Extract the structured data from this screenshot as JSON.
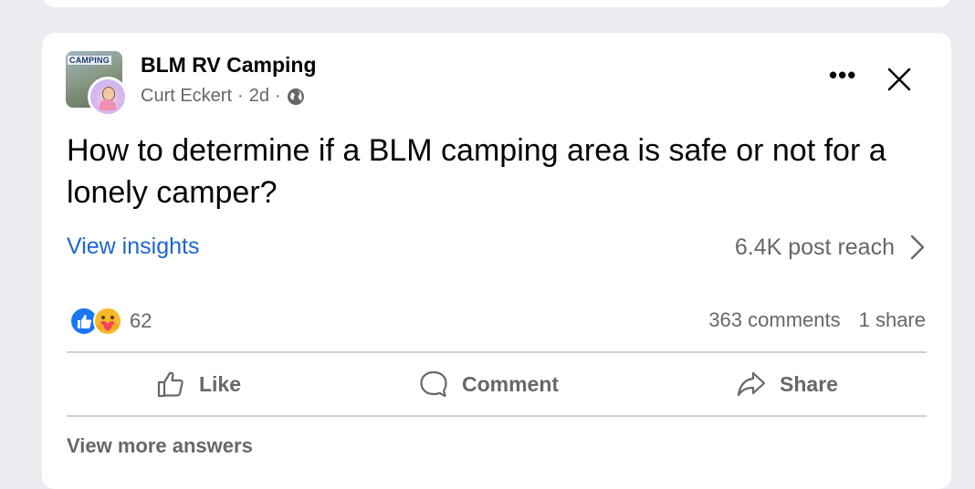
{
  "post": {
    "group_name": "BLM RV Camping",
    "group_avatar_text": "CAMPING",
    "author": "Curt Eckert",
    "time": "2d",
    "separator": "·",
    "text": "How to determine if a BLM camping area is safe or not for a lonely camper?",
    "more_label": "•••"
  },
  "insights": {
    "link_label": "View insights",
    "reach": "6.4K post reach"
  },
  "engagement": {
    "reaction_count": "62",
    "comments": "363 comments",
    "shares": "1 share"
  },
  "actions": {
    "like": "Like",
    "comment": "Comment",
    "share": "Share"
  },
  "footer": {
    "more_answers": "View more answers"
  },
  "colors": {
    "accent": "#1b65d0",
    "secondary_text": "#65676b",
    "like_blue": "#1877f2"
  }
}
